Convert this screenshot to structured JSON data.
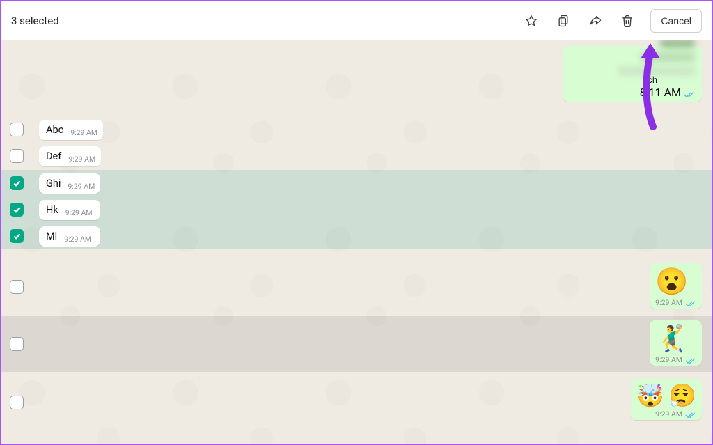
{
  "header": {
    "selection_text": "3 selected",
    "cancel_label": "Cancel"
  },
  "blurred_bubble": {
    "visible_tail": "ch",
    "time": "8:11 AM"
  },
  "incoming": [
    {
      "text": "Abc",
      "time": "9:29 AM",
      "checked": false
    },
    {
      "text": "Def",
      "time": "9:29 AM",
      "checked": false
    },
    {
      "text": "Ghi",
      "time": "9:29 AM",
      "checked": true
    },
    {
      "text": "Hk",
      "time": "9:29 AM",
      "checked": true
    },
    {
      "text": "Ml",
      "time": "9:29 AM",
      "checked": true
    }
  ],
  "outgoing": [
    {
      "emoji": "😮",
      "time": "9:29 AM"
    },
    {
      "emoji": "🤾‍♂️",
      "time": "9:29 AM"
    },
    {
      "emoji_pair": [
        "🤯",
        "😮‍💨"
      ],
      "time": "9:29 AM"
    }
  ]
}
